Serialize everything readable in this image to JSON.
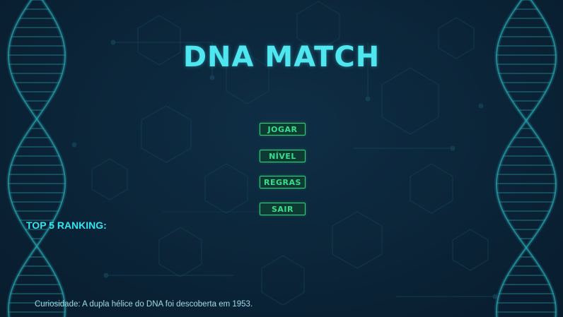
{
  "game": {
    "title": "DNA MATCH",
    "menu": [
      {
        "label": "JOGAR"
      },
      {
        "label": "NÍVEL"
      },
      {
        "label": "REGRAS"
      },
      {
        "label": "SAIR"
      }
    ],
    "ranking_title": "TOP 5 RANKING:",
    "curiosity": "Curiosidade: A dupla hélice do DNA foi descoberta em 1953."
  },
  "colors": {
    "background": "#0b2438",
    "title": "#4fe6ef",
    "button_border": "#2fd67a",
    "button_text": "#35e08a",
    "ranking": "#33e6f0"
  }
}
